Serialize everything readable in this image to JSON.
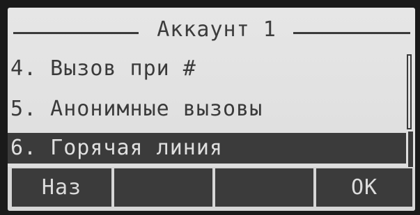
{
  "header": {
    "title": "Аккаунт 1"
  },
  "menu": {
    "items": [
      {
        "label": "4. Вызов при #"
      },
      {
        "label": "5. Анонимные вызовы"
      },
      {
        "label": "6. Горячая линия",
        "selected": true
      }
    ]
  },
  "softkeys": {
    "key1": "Наз",
    "key2": "",
    "key3": "",
    "key4": "OK"
  },
  "colors": {
    "screen_bg": "#e0e0e0",
    "pixel_dark": "#3a3a3a",
    "selection_bg": "#3b3b3b",
    "selection_text": "#e0e0e0"
  }
}
